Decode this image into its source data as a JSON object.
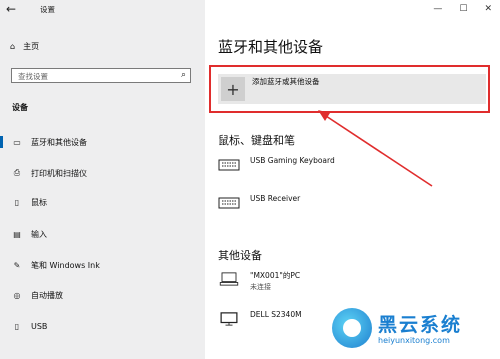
{
  "window": {
    "title": "设置",
    "back_icon": "back-arrow-icon",
    "controls": [
      "minimize-icon",
      "maximize-icon",
      "close-icon"
    ]
  },
  "sidebar": {
    "home_label": "主页",
    "search_placeholder": "查找设置",
    "section_label": "设备",
    "items": [
      {
        "label": "蓝牙和其他设备",
        "icon": "bluetooth-devices-icon",
        "active": true
      },
      {
        "label": "打印机和扫描仪",
        "icon": "printer-icon"
      },
      {
        "label": "鼠标",
        "icon": "mouse-icon"
      },
      {
        "label": "输入",
        "icon": "keyboard-icon"
      },
      {
        "label": "笔和 Windows Ink",
        "icon": "pen-icon"
      },
      {
        "label": "自动播放",
        "icon": "autoplay-icon"
      },
      {
        "label": "USB",
        "icon": "usb-icon"
      }
    ]
  },
  "main": {
    "title": "蓝牙和其他设备",
    "add_device_label": "添加蓝牙或其他设备",
    "group_mouse_keyboard": {
      "heading": "鼠标、键盘和笔",
      "devices": [
        {
          "name": "USB Gaming Keyboard",
          "icon": "keyboard-icon"
        },
        {
          "name": "USB Receiver",
          "icon": "keyboard-icon"
        }
      ]
    },
    "group_other": {
      "heading": "其他设备",
      "devices": [
        {
          "name": "\"MX001\"的PC",
          "status": "未连接",
          "icon": "pc-icon"
        },
        {
          "name": "DELL S2340M",
          "icon": "monitor-icon"
        }
      ]
    }
  },
  "watermark": {
    "brand": "黑云系统",
    "url": "heiyunxitong.com"
  },
  "colors": {
    "accent": "#0063b1",
    "highlight": "#e02d2d",
    "sidebar_bg": "#eeeeef"
  }
}
